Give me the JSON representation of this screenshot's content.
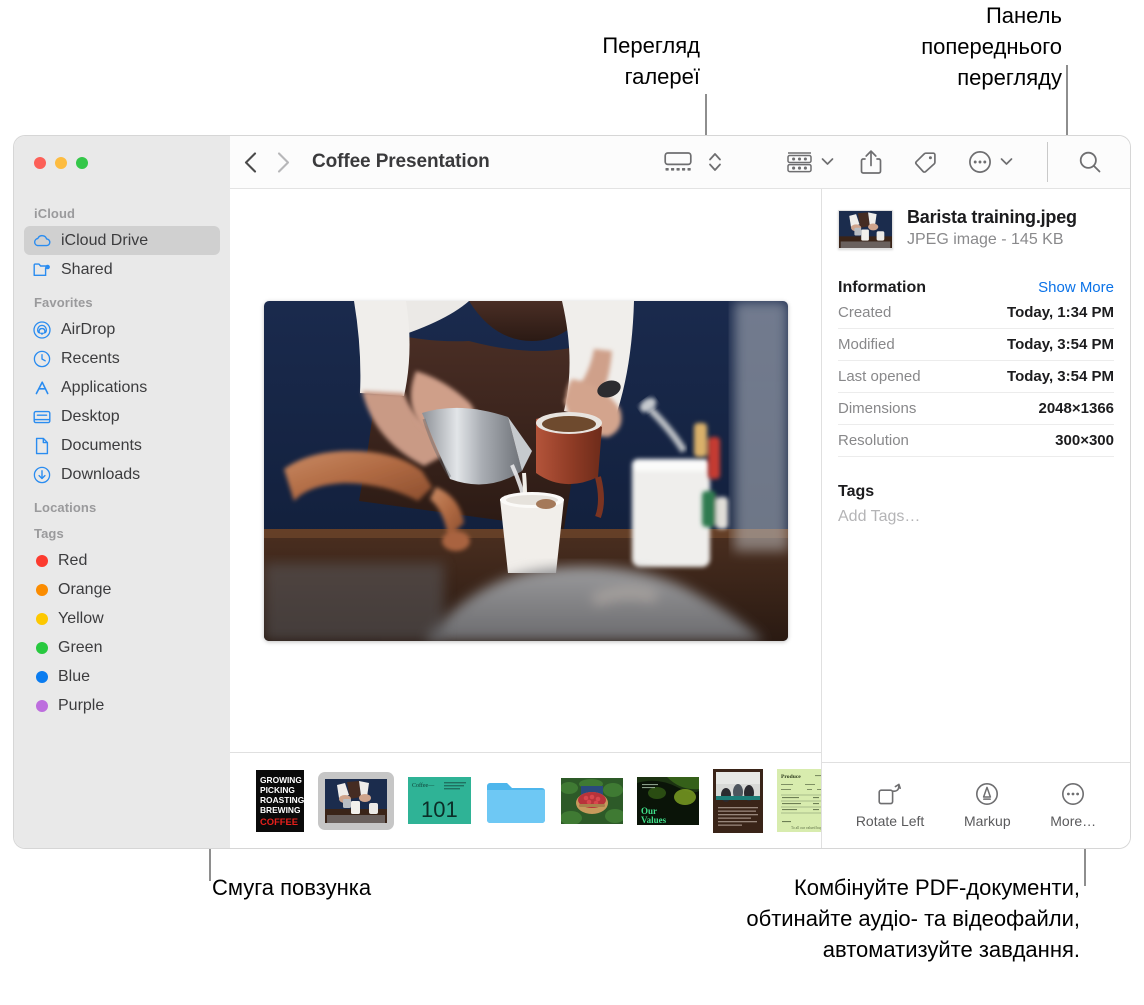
{
  "callouts": {
    "gallery_view": "Перегляд\nгалереї",
    "preview_panel": "Панель\nпопереднього\nперегляду",
    "scrollbar": "Смуга повзунка",
    "more_actions": "Комбінуйте PDF-документи,\nобтинайте аудіо- та відеофайли,\nавтоматизуйте завдання."
  },
  "window": {
    "title": "Coffee Presentation",
    "traffic_lights": [
      {
        "name": "close",
        "color": "#fc6058"
      },
      {
        "name": "minimize",
        "color": "#fdbc40"
      },
      {
        "name": "zoom",
        "color": "#34c749"
      }
    ],
    "toolbar_icons": [
      {
        "name": "back-icon",
        "label": "Back"
      },
      {
        "name": "forward-icon",
        "label": "Forward"
      },
      {
        "name": "gallery-view-icon",
        "label": "Gallery View"
      },
      {
        "name": "view-options-stepper-icon",
        "label": "View Options"
      },
      {
        "name": "group-items-icon",
        "label": "Group Items"
      },
      {
        "name": "share-icon",
        "label": "Share"
      },
      {
        "name": "tag-icon",
        "label": "Tags"
      },
      {
        "name": "more-actions-icon",
        "label": "More"
      },
      {
        "name": "search-icon",
        "label": "Search"
      }
    ]
  },
  "sidebar": {
    "sections": [
      {
        "header": "iCloud",
        "items": [
          {
            "label": "iCloud Drive",
            "icon": "cloud-icon",
            "selected": true
          },
          {
            "label": "Shared",
            "icon": "shared-folder-icon",
            "selected": false
          }
        ]
      },
      {
        "header": "Favorites",
        "items": [
          {
            "label": "AirDrop",
            "icon": "airdrop-icon",
            "selected": false
          },
          {
            "label": "Recents",
            "icon": "clock-icon",
            "selected": false
          },
          {
            "label": "Applications",
            "icon": "applications-icon",
            "selected": false
          },
          {
            "label": "Desktop",
            "icon": "desktop-icon",
            "selected": false
          },
          {
            "label": "Documents",
            "icon": "document-icon",
            "selected": false
          },
          {
            "label": "Downloads",
            "icon": "downloads-icon",
            "selected": false
          }
        ]
      },
      {
        "header": "Locations",
        "items": []
      },
      {
        "header": "Tags",
        "items": [
          {
            "label": "Red",
            "icon": "tag-dot",
            "color": "#fc3b2f",
            "selected": false
          },
          {
            "label": "Orange",
            "icon": "tag-dot",
            "color": "#fb8c00",
            "selected": false
          },
          {
            "label": "Yellow",
            "icon": "tag-dot",
            "color": "#fdc800",
            "selected": false
          },
          {
            "label": "Green",
            "icon": "tag-dot",
            "color": "#28c93f",
            "selected": false
          },
          {
            "label": "Blue",
            "icon": "tag-dot",
            "color": "#0a7cf0",
            "selected": false
          },
          {
            "label": "Purple",
            "icon": "tag-dot",
            "color": "#bd6ede",
            "selected": false
          }
        ]
      }
    ]
  },
  "filmstrip": {
    "items": [
      {
        "name": "growing-picking-roasting-brewing-coffee-poster",
        "selected": false
      },
      {
        "name": "barista-training-photo",
        "selected": true
      },
      {
        "name": "coffee-101-slide",
        "selected": false
      },
      {
        "name": "blue-folder",
        "selected": false
      },
      {
        "name": "coffee-cherries-basket-photo",
        "selected": false
      },
      {
        "name": "our-values-slide",
        "selected": false
      },
      {
        "name": "meeting-document",
        "selected": false
      },
      {
        "name": "produce-form-document",
        "selected": false
      }
    ]
  },
  "preview": {
    "file_name": "Barista training.jpeg",
    "file_kind": "JPEG image - 145 KB",
    "information_title": "Information",
    "show_more": "Show More",
    "rows": [
      {
        "key": "Created",
        "value": "Today, 1:34 PM"
      },
      {
        "key": "Modified",
        "value": "Today, 3:54 PM"
      },
      {
        "key": "Last opened",
        "value": "Today, 3:54 PM"
      },
      {
        "key": "Dimensions",
        "value": "2048×1366"
      },
      {
        "key": "Resolution",
        "value": "300×300"
      }
    ],
    "tags_title": "Tags",
    "add_tags_placeholder": "Add Tags…",
    "actions": [
      {
        "label": "Rotate Left",
        "icon": "rotate-left-icon"
      },
      {
        "label": "Markup",
        "icon": "markup-icon"
      },
      {
        "label": "More…",
        "icon": "more-circle-icon"
      }
    ]
  },
  "colors": {
    "accent_blue": "#0a72e8",
    "sidebar_bg": "#e9e9e9",
    "selection_bg": "#d0d0d0"
  }
}
